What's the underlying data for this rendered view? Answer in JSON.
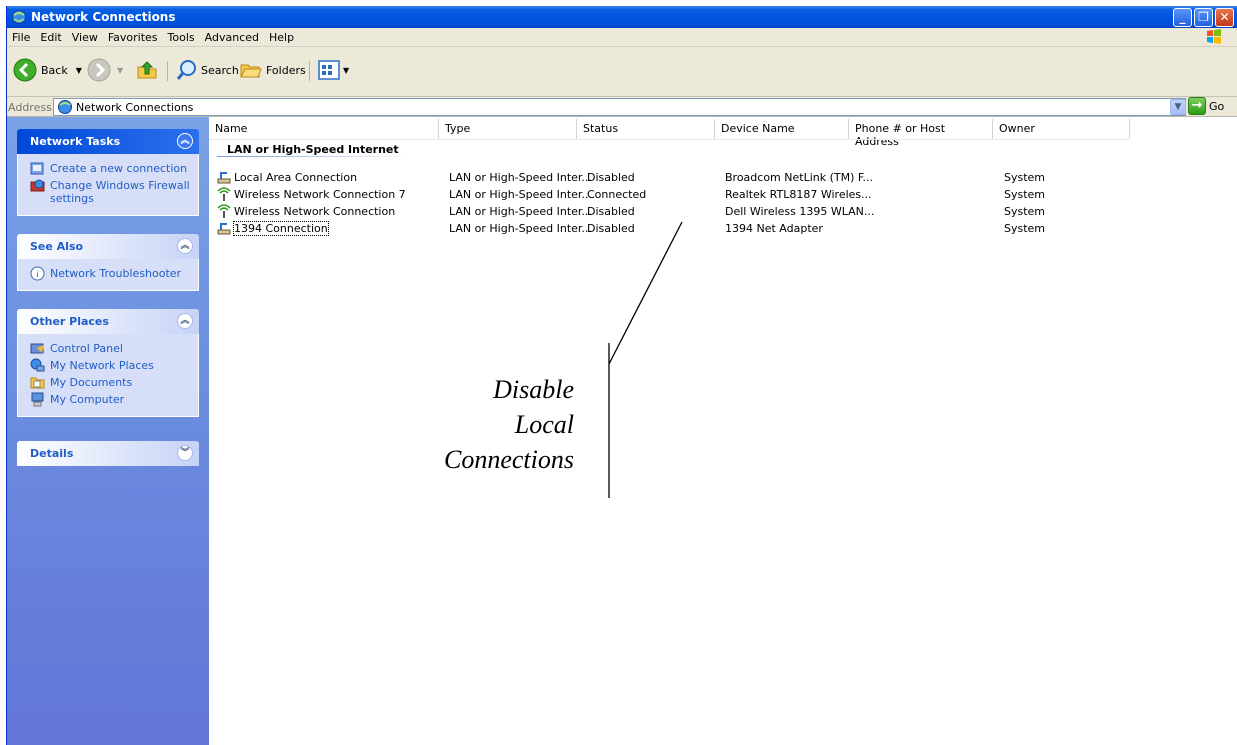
{
  "window": {
    "title": "Network Connections",
    "controls": [
      "minimize",
      "maximize",
      "close"
    ]
  },
  "menu": {
    "items": [
      "File",
      "Edit",
      "View",
      "Favorites",
      "Tools",
      "Advanced",
      "Help"
    ]
  },
  "toolbar": {
    "back_label": "Back",
    "search_label": "Search",
    "folders_label": "Folders"
  },
  "address": {
    "label": "Address",
    "value": "Network Connections",
    "go_label": "Go"
  },
  "taskpane": {
    "network_tasks": {
      "title": "Network Tasks",
      "items": [
        "Create a new connection",
        "Change Windows Firewall settings"
      ]
    },
    "see_also": {
      "title": "See Also",
      "items": [
        "Network Troubleshooter"
      ]
    },
    "other_places": {
      "title": "Other Places",
      "items": [
        "Control Panel",
        "My Network Places",
        "My Documents",
        "My Computer"
      ]
    },
    "details": {
      "title": "Details"
    }
  },
  "list": {
    "columns": [
      "Name",
      "Type",
      "Status",
      "Device Name",
      "Phone # or Host Address",
      "Owner"
    ],
    "group_title": "LAN or High-Speed Internet",
    "rows": [
      {
        "name": "Local Area Connection",
        "type": "LAN or High-Speed Inter...",
        "status": "Disabled",
        "device": "Broadcom NetLink (TM) F...",
        "phone": "",
        "owner": "System",
        "icon": "lan-icon"
      },
      {
        "name": "Wireless Network Connection 7",
        "type": "LAN or High-Speed Inter...",
        "status": "Connected",
        "device": "Realtek RTL8187 Wireles...",
        "phone": "",
        "owner": "System",
        "icon": "wireless-icon"
      },
      {
        "name": "Wireless Network Connection",
        "type": "LAN or High-Speed Inter...",
        "status": "Disabled",
        "device": "Dell Wireless 1395 WLAN...",
        "phone": "",
        "owner": "System",
        "icon": "wireless-icon"
      },
      {
        "name": "1394 Connection",
        "type": "LAN or High-Speed Inter...",
        "status": "Disabled",
        "device": "1394 Net Adapter",
        "phone": "",
        "owner": "System",
        "icon": "lan-icon"
      }
    ]
  },
  "annotation": {
    "lines": [
      "Disable",
      "Local",
      "Connections"
    ]
  },
  "colors": {
    "titlebar": "#0054e3",
    "taskpane": "#6b8fe0",
    "panel_link": "#215dc6",
    "chrome": "#ece9d8"
  }
}
